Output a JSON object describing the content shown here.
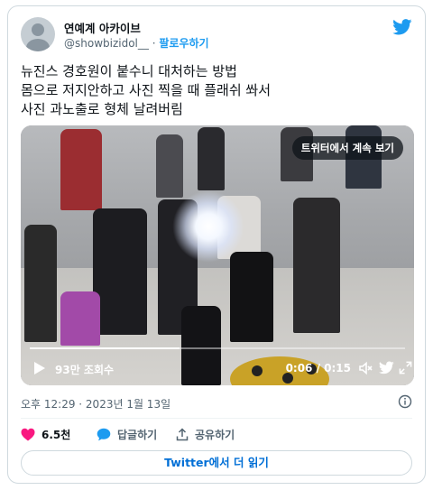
{
  "author": {
    "display_name": "연예계 아카이브",
    "handle": "@showbizidol__",
    "separator": "·",
    "follow_label": "팔로우하기"
  },
  "tweet": {
    "lines": [
      "뉴진스 경호원이 붙수니 대처하는 방법",
      "몸으로 저지안하고 사진 찍을 때 플래쉬 쏴서",
      "사진 과노출로 형체 날려버림"
    ],
    "timestamp": "오후 12:29 · 2023년 1월 13일"
  },
  "video": {
    "overlay_label": "트위터에서 계속 보기",
    "views": "93만 조회수",
    "time": "0:06 / 0:15",
    "progress": 0.4
  },
  "actions": {
    "like_count": "6.5천",
    "reply_label": "답글하기",
    "share_label": "공유하기"
  },
  "read_more_label": "Twitter에서 더 읽기",
  "colors": {
    "accent": "#1d9bf0",
    "like": "#f91880",
    "link": "#006fd6",
    "muted": "#536471"
  }
}
